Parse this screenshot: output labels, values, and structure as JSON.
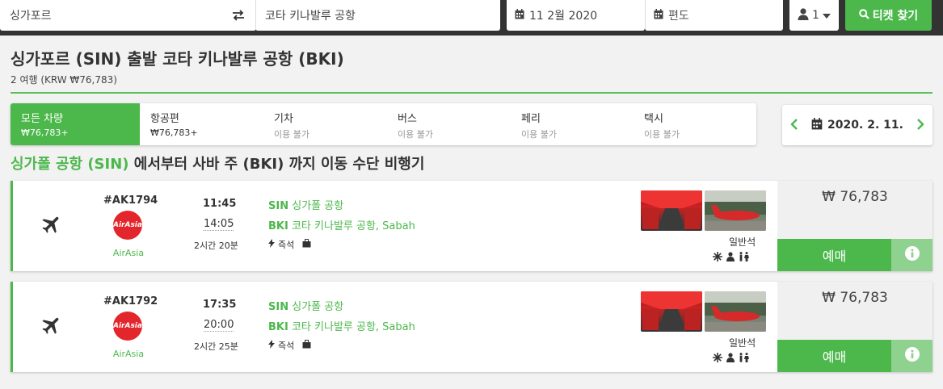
{
  "search": {
    "from": "싱가포르",
    "to": "코타 키나발루 공항",
    "date": "11 2월 2020",
    "return": "편도",
    "passengers": "1",
    "button_label": "티켓 찾기"
  },
  "header": {
    "title": "싱가포르 (SIN) 출발 코타 키나발루 공항 (BKI)",
    "subtitle": "2 여행 (KRW ₩76,783)"
  },
  "tabs": [
    {
      "label": "모든 차량",
      "sub": "₩76,783+"
    },
    {
      "label": "항공편",
      "sub": "₩76,783+"
    },
    {
      "label": "기차",
      "sub": "이용 불가"
    },
    {
      "label": "버스",
      "sub": "이용 불가"
    },
    {
      "label": "페리",
      "sub": "이용 불가"
    },
    {
      "label": "택시",
      "sub": "이용 불가"
    }
  ],
  "date_nav": {
    "date": "2020. 2. 11."
  },
  "section": {
    "title_highlight": "싱가폴 공항 (SIN)",
    "title_rest": " 에서부터 사바 주 (BKI) 까지 이동 수단 비행기"
  },
  "results": [
    {
      "flight": "#AK1794",
      "airline_logo": "AirAsia",
      "airline": "AirAsia",
      "depart": "11:45",
      "arrive": "14:05",
      "duration": "2시간 20분",
      "from_code": "SIN",
      "from_name": "싱가폴 공항",
      "to_code": "BKI",
      "to_name": "코타 키나발루 공항, Sabah",
      "feature": "즉석",
      "seat_class": "일반석",
      "price": "₩ 76,783",
      "book_label": "예매"
    },
    {
      "flight": "#AK1792",
      "airline_logo": "AirAsia",
      "airline": "AirAsia",
      "depart": "17:35",
      "arrive": "20:00",
      "duration": "2시간 25분",
      "from_code": "SIN",
      "from_name": "싱가폴 공항",
      "to_code": "BKI",
      "to_name": "코타 키나발루 공항, Sabah",
      "feature": "즉석",
      "seat_class": "일반석",
      "price": "₩ 76,783",
      "book_label": "예매"
    }
  ],
  "colors": {
    "accent": "#4cb84c",
    "topbar": "#333333",
    "airline_red": "#e3262b"
  }
}
